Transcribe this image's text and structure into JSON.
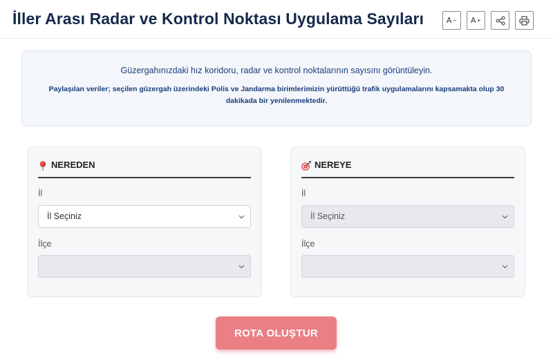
{
  "header": {
    "title": "İller Arası Radar ve Kontrol Noktası Uygulama Sayıları",
    "tools": {
      "font_decrease": "A",
      "font_increase": "A",
      "share_icon": "share-icon",
      "print_icon": "print-icon"
    }
  },
  "info": {
    "line1": "Güzergahınızdaki hız koridoru, radar ve kontrol noktalarının sayısını görüntüleyin.",
    "line2": "Paylaşılan veriler; seçilen güzergah üzerindeki Polis ve Jandarma birimlerimizin yürüttüğü trafik uygulamalarını kapsamakta olup 30 dakikada bir yenilenmektedir."
  },
  "from": {
    "icon": "map-pin-icon",
    "title": "NEREDEN",
    "province_label": "İl",
    "province_value": "İl Seçiniz",
    "district_label": "İlçe",
    "district_value": ""
  },
  "to": {
    "icon": "target-icon",
    "title": "NEREYE",
    "province_label": "İl",
    "province_value": "İl Seçiniz",
    "district_label": "İlçe",
    "district_value": ""
  },
  "actions": {
    "create_route": "ROTA OLUŞTUR"
  },
  "colors": {
    "title": "#15294b",
    "info_text": "#1c3f7a",
    "info_bg": "#f3f6fb",
    "button": "#ea7f86",
    "pin": "#e03b3b"
  }
}
